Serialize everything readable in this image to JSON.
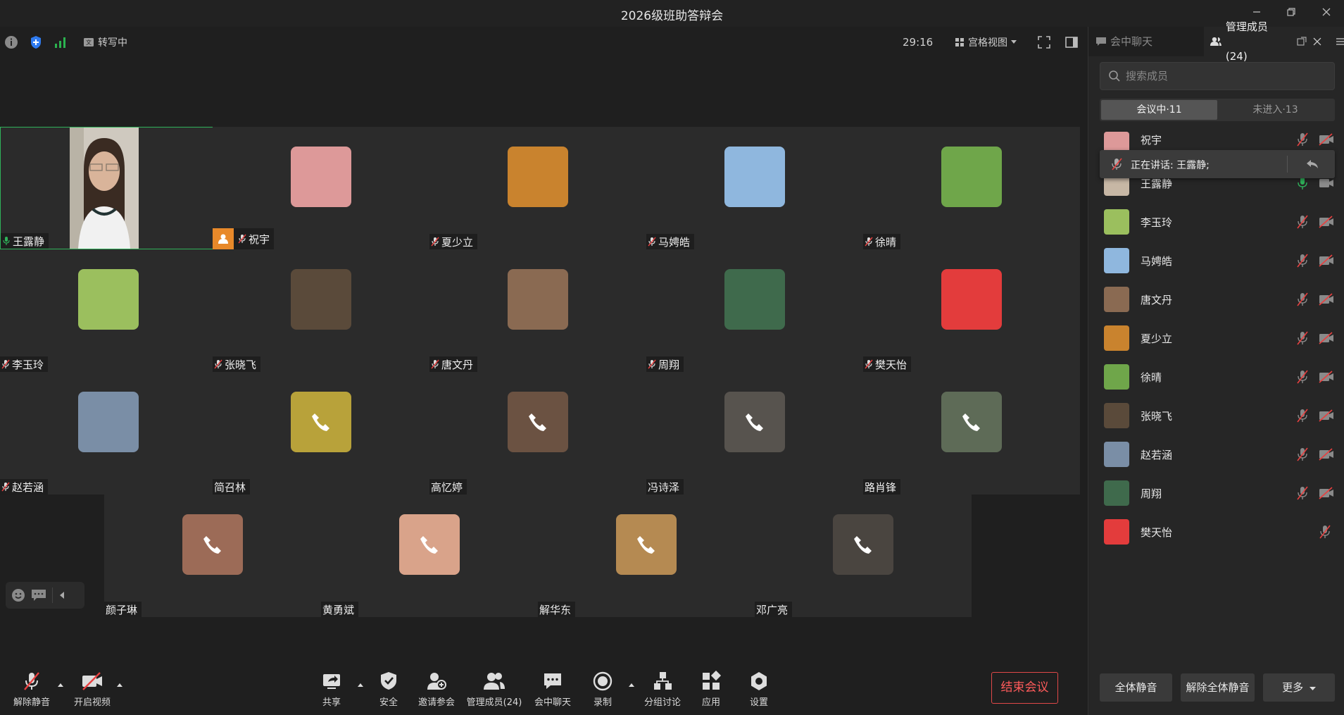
{
  "window": {
    "title": "2026级班助答辩会"
  },
  "topbar": {
    "transcribe_label": "转写中",
    "timer": "29:16",
    "view_label": "宫格视图"
  },
  "tiles": [
    {
      "name": "王露静",
      "mic": "on",
      "active": true,
      "kind": "video"
    },
    {
      "name": "祝宇",
      "mic": "muted",
      "host": true,
      "kind": "avatar",
      "color": "#d99"
    },
    {
      "name": "夏少立",
      "mic": "muted",
      "kind": "avatar",
      "color": "#c9832e"
    },
    {
      "name": "马娉皓",
      "mic": "muted",
      "kind": "avatar",
      "color": "#8fb7de"
    },
    {
      "name": "徐晴",
      "mic": "muted",
      "kind": "avatar",
      "color": "#6fa64a"
    },
    {
      "name": "李玉玲",
      "mic": "muted",
      "kind": "avatar",
      "color": "#9bbf5e"
    },
    {
      "name": "张晓飞",
      "mic": "muted",
      "kind": "avatar",
      "color": "#5a4a3a"
    },
    {
      "name": "唐文丹",
      "mic": "muted",
      "kind": "avatar",
      "color": "#8a6a52"
    },
    {
      "name": "周翔",
      "mic": "muted",
      "kind": "avatar",
      "color": "#3f6a4c"
    },
    {
      "name": "樊天怡",
      "mic": "muted",
      "kind": "avatar",
      "color": "#e33c3c"
    },
    {
      "name": "赵若涵",
      "mic": "muted",
      "kind": "avatar",
      "color": "#7a8ea6"
    },
    {
      "name": "简召林",
      "mic": "none",
      "kind": "phone",
      "color": "#b8a23a"
    },
    {
      "name": "高忆婷",
      "mic": "none",
      "kind": "phone",
      "color": "#6b5242"
    },
    {
      "name": "冯诗泽",
      "mic": "none",
      "kind": "phone",
      "color": "#57534e"
    },
    {
      "name": "路肖锋",
      "mic": "none",
      "kind": "phone",
      "color": "#5e6b57"
    },
    {
      "name": "颜子琳",
      "mic": "none",
      "kind": "phone",
      "color": "#9c6b57"
    },
    {
      "name": "黄勇斌",
      "mic": "none",
      "kind": "phone",
      "color": "#d9a38a"
    },
    {
      "name": "解华东",
      "mic": "none",
      "kind": "phone",
      "color": "#b58a52"
    },
    {
      "name": "邓广亮",
      "mic": "none",
      "kind": "phone",
      "color": "#4a4540"
    }
  ],
  "toolbar": {
    "unmute": "解除静音",
    "start_video": "开启视频",
    "share": "共享",
    "security": "安全",
    "invite": "邀请参会",
    "members": "管理成员(24)",
    "chat": "会中聊天",
    "record": "录制",
    "breakout": "分组讨论",
    "apps": "应用",
    "settings": "设置",
    "end_meeting": "结束会议"
  },
  "panel": {
    "tab_chat": "会中聊天",
    "tab_members": "管理成员(24)",
    "search_placeholder": "搜索成员",
    "seg_in": "会议中·11",
    "seg_out": "未进入·13",
    "speaking_text": "正在讲话: 王露静;",
    "members": [
      {
        "name": "祝宇",
        "color": "#d99",
        "mic": "muted",
        "cam": "off"
      },
      {
        "name": "王露静",
        "color": "#c7b7a5",
        "mic": "on",
        "cam": "on"
      },
      {
        "name": "李玉玲",
        "color": "#9bbf5e",
        "mic": "muted",
        "cam": "off"
      },
      {
        "name": "马娉皓",
        "color": "#8fb7de",
        "mic": "muted",
        "cam": "off"
      },
      {
        "name": "唐文丹",
        "color": "#8a6a52",
        "mic": "muted",
        "cam": "off"
      },
      {
        "name": "夏少立",
        "color": "#c9832e",
        "mic": "muted",
        "cam": "off"
      },
      {
        "name": "徐晴",
        "color": "#6fa64a",
        "mic": "muted",
        "cam": "off"
      },
      {
        "name": "张晓飞",
        "color": "#5a4a3a",
        "mic": "muted",
        "cam": "off"
      },
      {
        "name": "赵若涵",
        "color": "#7a8ea6",
        "mic": "muted",
        "cam": "off"
      },
      {
        "name": "周翔",
        "color": "#3f6a4c",
        "mic": "muted",
        "cam": "off"
      },
      {
        "name": "樊天怡",
        "color": "#e33c3c",
        "mic": "muted",
        "cam": "none"
      }
    ],
    "mute_all": "全体静音",
    "unmute_all": "解除全体静音",
    "more": "更多"
  }
}
